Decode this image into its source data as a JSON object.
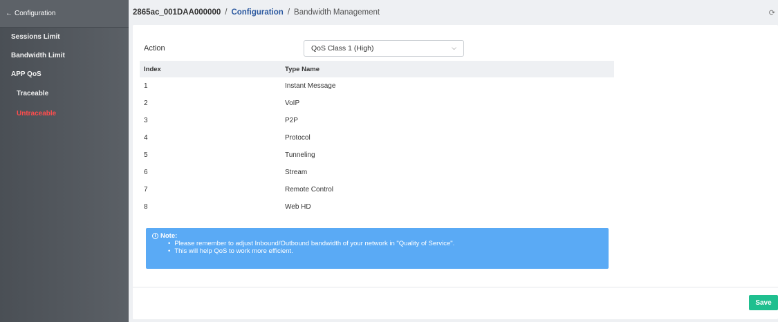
{
  "sidebar": {
    "back_label": "Configuration",
    "items": [
      {
        "label": "Sessions Limit"
      },
      {
        "label": "Bandwidth Limit"
      },
      {
        "label": "APP QoS"
      }
    ],
    "subitems": [
      {
        "label": "Traceable",
        "active": false
      },
      {
        "label": "Untraceable",
        "active": true
      }
    ],
    "active_color": "#ff4d4d"
  },
  "header": {
    "device": "2865ac_001DAA000000",
    "separator": "/",
    "section": "Configuration",
    "page": "Bandwidth Management"
  },
  "form": {
    "action_label": "Action",
    "action_value": "QoS Class 1 (High)"
  },
  "table": {
    "headers": [
      "Index",
      "Type Name"
    ],
    "rows": [
      [
        "1",
        "Instant Message"
      ],
      [
        "2",
        "VoIP"
      ],
      [
        "3",
        "P2P"
      ],
      [
        "4",
        "Protocol"
      ],
      [
        "5",
        "Tunneling"
      ],
      [
        "6",
        "Stream"
      ],
      [
        "7",
        "Remote Control"
      ],
      [
        "8",
        "Web HD"
      ]
    ]
  },
  "note": {
    "title": "Note:",
    "lines": [
      "Please remember to adjust Inbound/Outbound bandwidth of your network in \"Quality of Service\".",
      "This will help QoS to work more efficient."
    ],
    "color": "#5aaaf5"
  },
  "footer": {
    "save_label": "Save",
    "save_color": "#1fbf8f"
  }
}
